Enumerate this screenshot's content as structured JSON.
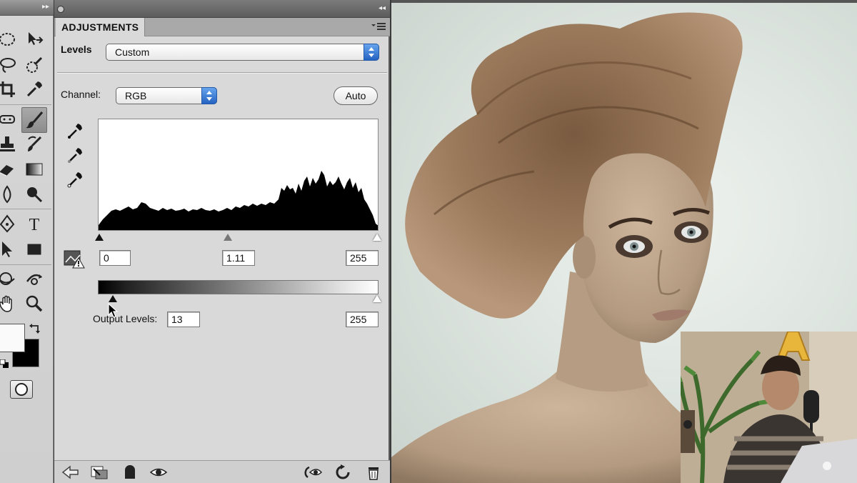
{
  "tools_panel": {
    "tools": [
      {
        "name": "marquee-tool-icon"
      },
      {
        "name": "move-tool-icon"
      },
      {
        "name": "lasso-tool-icon"
      },
      {
        "name": "quick-selection-tool-icon"
      },
      {
        "name": "crop-tool-icon"
      },
      {
        "name": "eyedropper-tool-icon"
      },
      {
        "name": "healing-brush-tool-icon"
      },
      {
        "name": "brush-tool-icon"
      },
      {
        "name": "clone-stamp-tool-icon"
      },
      {
        "name": "history-brush-tool-icon"
      },
      {
        "name": "eraser-tool-icon"
      },
      {
        "name": "gradient-tool-icon"
      },
      {
        "name": "blur-tool-icon"
      },
      {
        "name": "dodge-tool-icon"
      },
      {
        "name": "pen-tool-icon"
      },
      {
        "name": "type-tool-icon"
      },
      {
        "name": "path-selection-tool-icon"
      },
      {
        "name": "rectangle-tool-icon"
      },
      {
        "name": "3d-rotate-tool-icon"
      },
      {
        "name": "3d-orbit-tool-icon"
      },
      {
        "name": "hand-tool-icon"
      },
      {
        "name": "zoom-tool-icon"
      }
    ],
    "selected_tool": "brush-tool-icon",
    "foreground_color": "#fafafa",
    "background_color": "#000000"
  },
  "adjustments": {
    "tab_label": "ADJUSTMENTS",
    "adjustment_label": "Levels",
    "preset_value": "Custom",
    "channel_label": "Channel:",
    "channel_value": "RGB",
    "auto_label": "Auto",
    "input_levels": {
      "black": "0",
      "gamma": "1.11",
      "white": "255"
    },
    "output_label": "Output Levels:",
    "output_levels": {
      "black": "13",
      "white": "255"
    }
  },
  "bottom_icons": [
    "back-arrow-icon",
    "clip-to-layer-icon",
    "toggle-visibility-icon",
    "view-eye-icon",
    "view-previous-icon",
    "reset-icon",
    "delete-icon"
  ],
  "colors": {
    "panel_bg": "#d9d9d9",
    "popup_accent": "#2f6fcf",
    "canvas_bg": "#dfe6e1"
  }
}
